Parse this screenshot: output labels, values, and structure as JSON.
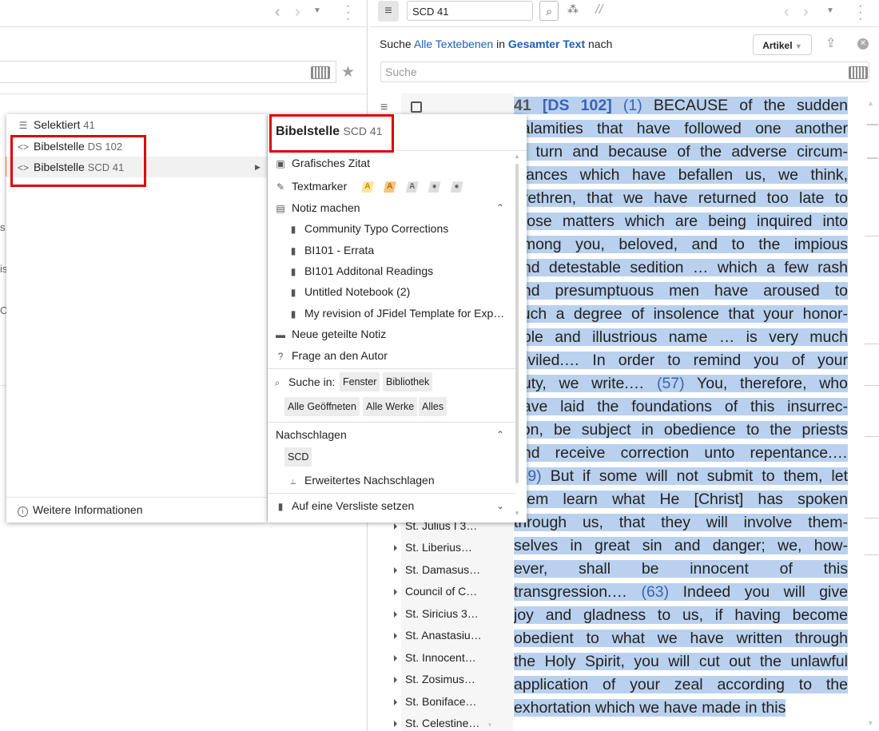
{
  "left_panel": {
    "side_fragments": [
      "s /",
      "is",
      "C"
    ]
  },
  "right_panel": {
    "search_box_value": "SCD 41",
    "search_line": {
      "prefix": "Suche",
      "scope1": "Alle Textebenen",
      "mid": "in",
      "scope2": "Gesamter Text",
      "suffix": "nach"
    },
    "artikel_label": "Artikel",
    "search_placeholder": "Suche",
    "toc_items": [
      "St. Julius I 3…",
      "St. Liberius…",
      "St. Damasus…",
      "Council of C…",
      "St. Siricius 3…",
      "St. Anastasiu…",
      "St. Innocent…",
      "St. Zosimus…",
      "St. Boniface…",
      "St. Celestine…"
    ],
    "reading_lead_number": "41",
    "reading_lead_ref": "[DS 102]",
    "reading_lines": [
      {
        "pre": "",
        "num": "(1)",
        "txt": " BECAUSE of the sudden"
      },
      {
        "pre": "calamities that have followed one another",
        "num": "",
        "txt": ""
      },
      {
        "pre": "in turn and because of the adverse circum-",
        "num": "",
        "txt": ""
      },
      {
        "pre": "stances which have befallen us, we think,",
        "num": "",
        "txt": ""
      },
      {
        "pre": "brethren, that we have returned too late to",
        "num": "",
        "txt": ""
      },
      {
        "pre": "those matters which are being inquired into",
        "num": "",
        "txt": ""
      },
      {
        "pre": "among you, beloved, and to the impious",
        "num": "",
        "txt": ""
      },
      {
        "pre": "and detestable sedition … which a few rash",
        "num": "",
        "txt": ""
      },
      {
        "pre": "and presumptuous men have aroused to",
        "num": "",
        "txt": ""
      },
      {
        "pre": "such a degree of insolence that your honor-",
        "num": "",
        "txt": ""
      },
      {
        "pre": "able and illustrious name … is very much",
        "num": "",
        "txt": ""
      },
      {
        "pre": "reviled.… In order to remind you of your",
        "num": "",
        "txt": ""
      },
      {
        "pre": "duty, we write.… ",
        "num": "(57)",
        "txt": " You, therefore, who"
      },
      {
        "pre": "have laid the foundations of this insurrec-",
        "num": "",
        "txt": ""
      },
      {
        "pre": "tion, be subject in obedience to the priests",
        "num": "",
        "txt": ""
      },
      {
        "pre": "and receive correction unto repentance.…",
        "num": "",
        "txt": ""
      },
      {
        "pre": "",
        "num": "(59)",
        "txt": " But if some will not submit to them, let"
      },
      {
        "pre": "them learn what He [Christ] has spoken",
        "num": "",
        "txt": ""
      },
      {
        "pre": "through us, that they will involve them-",
        "num": "",
        "txt": ""
      },
      {
        "pre": "selves in great sin and danger; we, how-",
        "num": "",
        "txt": ""
      },
      {
        "pre": "ever, shall be innocent of this",
        "num": "",
        "txt": ""
      },
      {
        "pre": "transgression.… ",
        "num": "(63)",
        "txt": " Indeed you will give"
      },
      {
        "pre": "joy and gladness to us, if having become",
        "num": "",
        "txt": ""
      },
      {
        "pre": "obedient to what we have written through",
        "num": "",
        "txt": ""
      },
      {
        "pre": "the Holy Spirit, you will cut out the unlawful",
        "num": "",
        "txt": ""
      },
      {
        "pre": "application of your zeal according to the",
        "num": "",
        "txt": ""
      },
      {
        "pre": "exhortation which we have made in this",
        "num": "",
        "txt": ""
      }
    ]
  },
  "context_menu": {
    "left": {
      "selected_label": "Selektiert",
      "selected_value": "41",
      "ref1_label": "Bibelstelle",
      "ref1_value": "DS 102",
      "ref2_label": "Bibelstelle",
      "ref2_value": "SCD 41",
      "more_info": "Weitere Informationen"
    },
    "right": {
      "title_label": "Bibelstelle",
      "title_value": "SCD 41",
      "graphic_quote": "Grafisches Zitat",
      "highlighter": "Textmarker",
      "highlighter_swatches": [
        "A",
        "A",
        "A"
      ],
      "make_note": "Notiz machen",
      "notebooks": [
        "Community Typo Corrections",
        "BI101 - Errata",
        "BI101 Additonal Readings",
        "Untitled Notebook (2)",
        "My revision of JFidel Template for Exp…"
      ],
      "shared_note": "Neue geteilte Notiz",
      "ask_author": "Frage an den Autor",
      "search_in": "Suche in:",
      "search_chips_row1": [
        "Fenster",
        "Bibliothek"
      ],
      "search_chips_row2": [
        "Alle Geöffneten",
        "Alle Werke",
        "Alles"
      ],
      "lookup_header": "Nachschlagen",
      "lookup_chip": "SCD",
      "advanced_lookup": "Erweitertes Nachschlagen",
      "verse_list": "Auf eine Versliste setzen"
    }
  },
  "colors": {
    "highlight": "#b9d1ee",
    "link": "#1e5fb3",
    "red_box": "#e00000",
    "swatch_orange": "#f6c47a"
  }
}
